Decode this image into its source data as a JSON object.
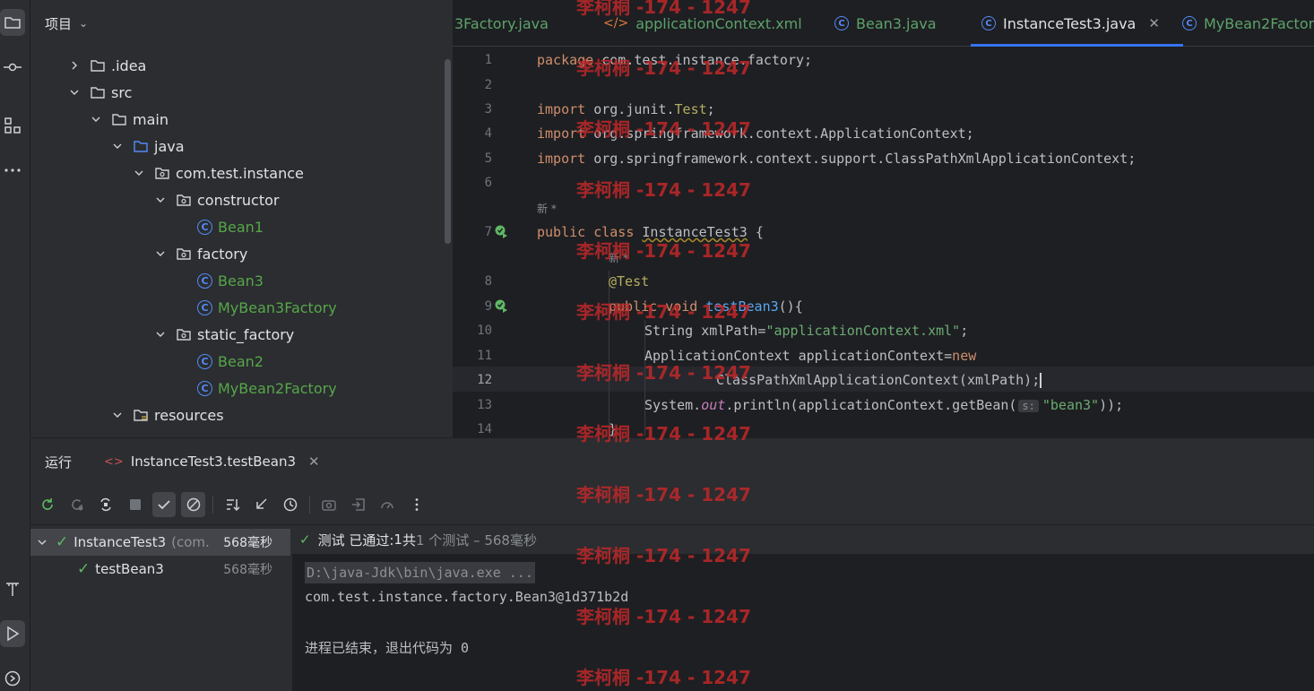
{
  "project": {
    "title": "项目",
    "tree": [
      {
        "label": ".idea",
        "kind": "folder",
        "expanded": false
      },
      {
        "label": "src",
        "kind": "folder",
        "expanded": true
      },
      {
        "label": "main",
        "kind": "folder",
        "expanded": true
      },
      {
        "label": "java",
        "kind": "source-folder",
        "expanded": true
      },
      {
        "label": "com.test.instance",
        "kind": "package",
        "expanded": true
      },
      {
        "label": "constructor",
        "kind": "package",
        "expanded": true
      },
      {
        "label": "Bean1",
        "kind": "class"
      },
      {
        "label": "factory",
        "kind": "package",
        "expanded": true
      },
      {
        "label": "Bean3",
        "kind": "class"
      },
      {
        "label": "MyBean3Factory",
        "kind": "class"
      },
      {
        "label": "static_factory",
        "kind": "package",
        "expanded": true
      },
      {
        "label": "Bean2",
        "kind": "class"
      },
      {
        "label": "MyBean2Factory",
        "kind": "class"
      },
      {
        "label": "resources",
        "kind": "resources-folder",
        "expanded": true
      }
    ]
  },
  "editor": {
    "tabs": [
      {
        "label": "3Factory.java",
        "icon": "class-icon"
      },
      {
        "label": "applicationContext.xml",
        "icon": "xml-icon"
      },
      {
        "label": "Bean3.java",
        "icon": "class-icon"
      },
      {
        "label": "InstanceTest3.java",
        "icon": "class-icon",
        "active": true
      },
      {
        "label": "MyBean2Factor",
        "icon": "class-icon"
      }
    ],
    "line_numbers": [
      "1",
      "2",
      "3",
      "4",
      "5",
      "6",
      "7",
      "8",
      "9",
      "10",
      "11",
      "12",
      "13",
      "14"
    ],
    "current_line": "12",
    "inlay_new": "新 *",
    "code": {
      "l1_kw": "package",
      "l1_rest": " com.test.instance.factory;",
      "l3_kw": "import",
      "l3_rest": " org.junit.",
      "l3_ann": "Test",
      "l3_end": ";",
      "l4_kw": "import",
      "l4_rest": " org.springframework.context.ApplicationContext;",
      "l5_kw": "import",
      "l5_rest": " org.springframework.context.support.ClassPathXmlApplicationContext;",
      "l7_kw1": "public",
      "l7_kw2": "class",
      "l7_name": "InstanceTest3",
      "l7_end": " {",
      "l8_ann": "@Test",
      "l9_kw1": "public",
      "l9_kw2": "void",
      "l9_fn": "testBean3",
      "l9_end": "(){",
      "l10_a": "String xmlPath=",
      "l10_str": "\"applicationContext.xml\"",
      "l10_end": ";",
      "l11_a": "ApplicationContext applicationContext=",
      "l11_kw": "new",
      "l12_a": "ClassPathXmlApplicationContext(xmlPath);",
      "l13_a": "System.",
      "l13_it": "out",
      "l13_b": ".println(applicationContext.getBean(",
      "l13_hint": "s:",
      "l13_str": "\"bean3\"",
      "l13_end": "));",
      "l14_a": "}"
    }
  },
  "run": {
    "title": "运行",
    "tab_label": "InstanceTest3.testBean3",
    "tests": [
      {
        "name": "InstanceTest3",
        "pkg": "(com.",
        "duration": "568毫秒",
        "selected": true
      },
      {
        "name": "testBean3",
        "duration": "568毫秒"
      }
    ],
    "status": {
      "prefix": "测试 已通过:",
      "passed": " 1",
      "total": "共 ",
      "total_rest": "1 个测试 – 568毫秒"
    },
    "console": {
      "cmd": "D:\\java-Jdk\\bin\\java.exe ...",
      "output": "com.test.instance.factory.Bean3@1d371b2d",
      "exit": "进程已结束，退出代码为 0"
    }
  },
  "watermark": "李柯桐 -174 - 1247",
  "colors": {
    "accent": "#3574f0",
    "keyword": "#cf8e6d",
    "string": "#6aab73",
    "success": "#5fb865",
    "watermark": "#c0282a"
  }
}
